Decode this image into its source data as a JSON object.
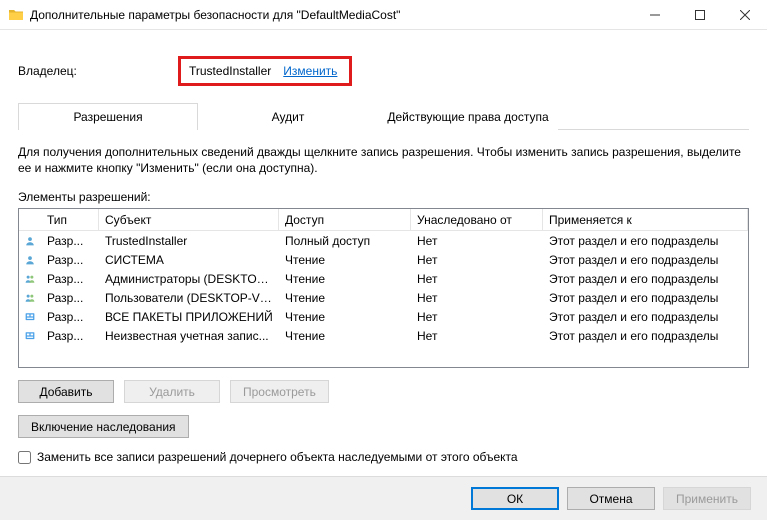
{
  "titlebar": {
    "title": "Дополнительные параметры безопасности  для \"DefaultMediaCost\""
  },
  "owner": {
    "label": "Владелец:",
    "name": "TrustedInstaller",
    "change_link": "Изменить"
  },
  "tabs": [
    {
      "label": "Разрешения",
      "active": true
    },
    {
      "label": "Аудит",
      "active": false
    },
    {
      "label": "Действующие права доступа",
      "active": false
    }
  ],
  "hint": "Для получения дополнительных сведений дважды щелкните запись разрешения. Чтобы изменить запись разрешения, выделите ее и нажмите кнопку \"Изменить\" (если она доступна).",
  "list": {
    "label": "Элементы разрешений:",
    "columns": [
      "",
      "Тип",
      "Субъект",
      "Доступ",
      "Унаследовано от",
      "Применяется к"
    ],
    "rows": [
      {
        "icon": "user",
        "type": "Разр...",
        "subject": "TrustedInstaller",
        "access": "Полный доступ",
        "inherited": "Нет",
        "applies": "Этот раздел и его подразделы"
      },
      {
        "icon": "user",
        "type": "Разр...",
        "subject": "СИСТЕМА",
        "access": "Чтение",
        "inherited": "Нет",
        "applies": "Этот раздел и его подразделы"
      },
      {
        "icon": "group",
        "type": "Разр...",
        "subject": "Администраторы (DESKTOP-...",
        "access": "Чтение",
        "inherited": "Нет",
        "applies": "Этот раздел и его подразделы"
      },
      {
        "icon": "group",
        "type": "Разр...",
        "subject": "Пользователи (DESKTOP-VN...",
        "access": "Чтение",
        "inherited": "Нет",
        "applies": "Этот раздел и его подразделы"
      },
      {
        "icon": "app",
        "type": "Разр...",
        "subject": "ВСЕ ПАКЕТЫ ПРИЛОЖЕНИЙ",
        "access": "Чтение",
        "inherited": "Нет",
        "applies": "Этот раздел и его подразделы"
      },
      {
        "icon": "app",
        "type": "Разр...",
        "subject": "Неизвестная учетная запис...",
        "access": "Чтение",
        "inherited": "Нет",
        "applies": "Этот раздел и его подразделы"
      }
    ]
  },
  "buttons": {
    "add": "Добавить",
    "remove": "Удалить",
    "view": "Просмотреть",
    "enable_inherit": "Включение наследования"
  },
  "replace_checkbox": {
    "label": "Заменить все записи разрешений дочернего объекта наследуемыми от этого объекта",
    "checked": false
  },
  "footer": {
    "ok": "ОК",
    "cancel": "Отмена",
    "apply": "Применить"
  }
}
